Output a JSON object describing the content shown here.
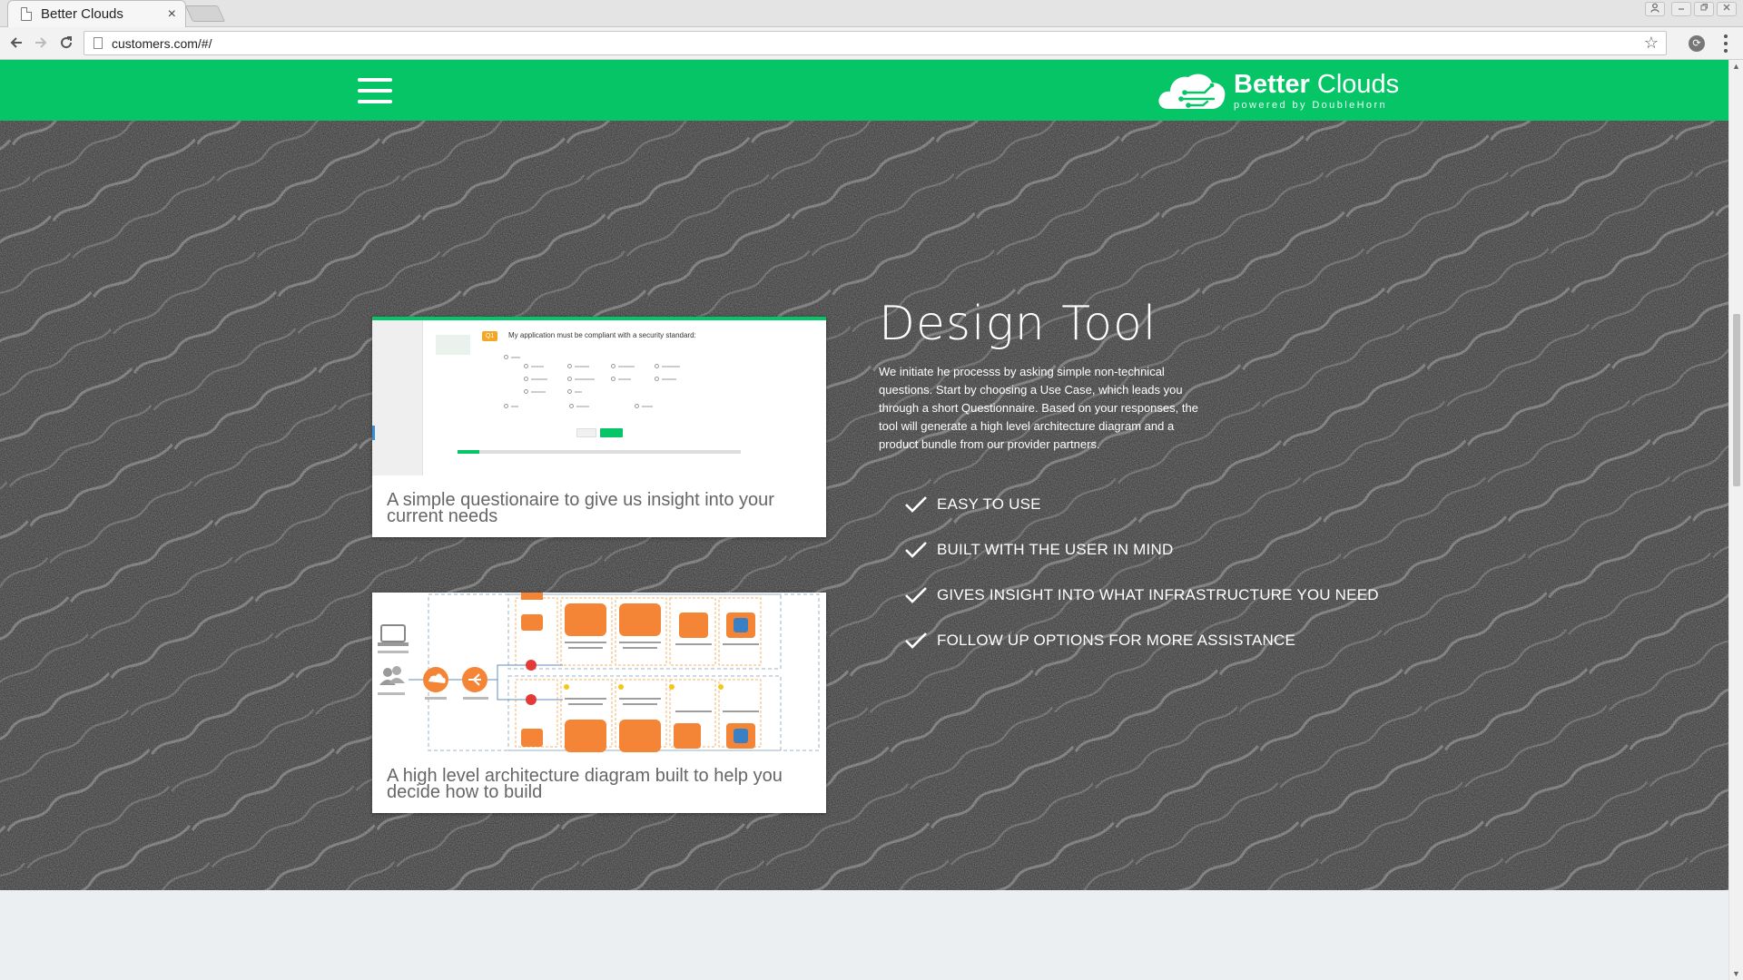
{
  "browser": {
    "tab_title": "Better Clouds",
    "tab_close": "×",
    "url": "customers.com/#/",
    "star": "☆"
  },
  "header": {
    "brand_bold": "Better",
    "brand_light": "Clouds",
    "brand_sub": "powered by DoubleHorn",
    "brand_color": "#06c567"
  },
  "design": {
    "title": "Design Tool",
    "description": "We initiate he processs by asking simple non-technical questions. Start by choosing a Use Case, which leads you through a short Questionnaire. Based on your responses, the tool will generate a high level architecture diagram and a product bundle from our provider partners.",
    "features": [
      "EASY TO USE",
      "BUILT WITH THE USER IN MIND",
      "GIVES INSIGHT INTO WHAT INFRASTRUCTURE YOU NEED",
      "FOLLOW UP OPTIONS FOR MORE ASSISTANCE"
    ]
  },
  "cards": [
    {
      "caption": "A simple questionaire to give us insight into your current needs",
      "screenshot": {
        "badge": "Q1",
        "question": "My application must be compliant with a security standard:"
      }
    },
    {
      "caption": "A high level architecture diagram built to help you decide how to build"
    }
  ],
  "colors": {
    "accent": "#06c567",
    "hero_bg": "#2c2c2c",
    "aws_orange": "#f58536"
  }
}
